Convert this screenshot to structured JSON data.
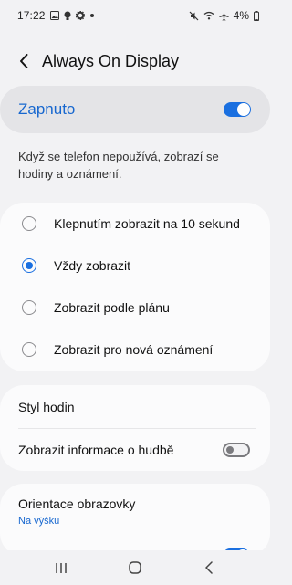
{
  "status_bar": {
    "time": "17:22",
    "battery": "4%",
    "left_icons": [
      "gallery-icon",
      "bulb-icon",
      "gear-icon",
      "dot-icon"
    ],
    "right_icons": [
      "mute-icon",
      "wifi-icon",
      "airplane-icon",
      "battery-icon"
    ]
  },
  "header": {
    "title": "Always On Display",
    "back_icon": "back-arrow-icon"
  },
  "master_toggle": {
    "label": "Zapnuto",
    "state": "on",
    "accent_color": "#1a6fe0"
  },
  "description": "Když se telefon nepoužívá, zobrazí se hodiny a oznámení.",
  "display_options": [
    {
      "label": "Klepnutím zobrazit na 10 sekund",
      "selected": false
    },
    {
      "label": "Vždy zobrazit",
      "selected": true
    },
    {
      "label": "Zobrazit podle plánu",
      "selected": false
    },
    {
      "label": "Zobrazit pro nová oznámení",
      "selected": false
    }
  ],
  "settings": {
    "clock_style": "Styl hodin",
    "music_info": {
      "label": "Zobrazit informace o hudbě",
      "state": "off"
    }
  },
  "orientation": {
    "title": "Orientace obrazovky",
    "value": "Na výšku"
  },
  "nav_bar": {
    "icons": [
      "recent-apps-icon",
      "home-icon",
      "back-icon"
    ]
  }
}
